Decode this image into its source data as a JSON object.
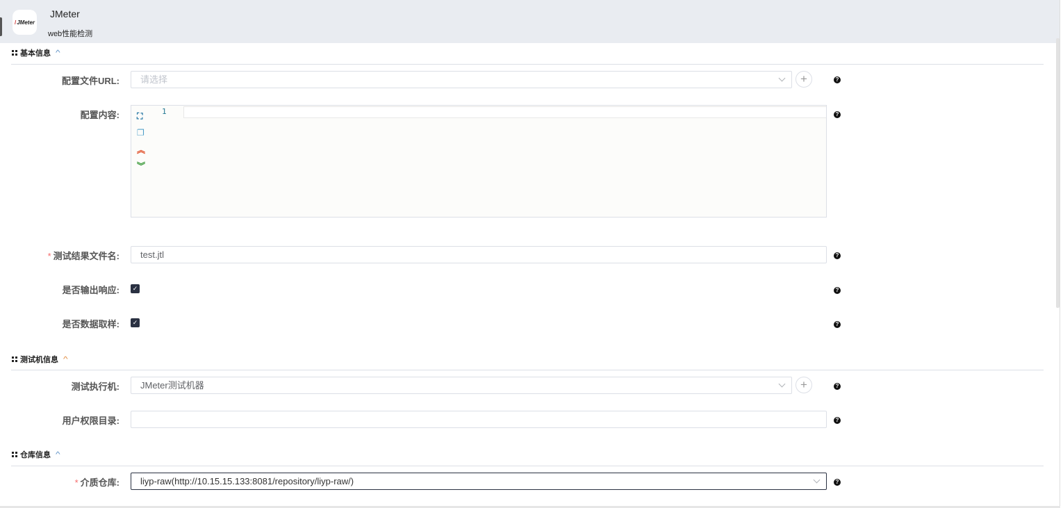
{
  "header": {
    "title": "JMeter",
    "subtitle": "web性能检测",
    "logo_text": "JMeter"
  },
  "sections": {
    "basic": {
      "title": "基本信息"
    },
    "machine": {
      "title": "测试机信息"
    },
    "repo": {
      "title": "仓库信息"
    }
  },
  "fields": {
    "config_url": {
      "label": "配置文件URL:",
      "placeholder": "请选择"
    },
    "config_content": {
      "label": "配置内容:",
      "line_number": "1"
    },
    "result_file": {
      "label": "测试结果文件名:",
      "value": "test.jtl",
      "required": "*"
    },
    "output_response": {
      "label": "是否输出响应:",
      "checked": true
    },
    "data_sampling": {
      "label": "是否数据取样:",
      "checked": true
    },
    "executor": {
      "label": "测试执行机:",
      "value": "JMeter测试机器"
    },
    "user_dir": {
      "label": "用户权限目录:",
      "value": ""
    },
    "repository": {
      "label": "介质仓库:",
      "value": "liyp-raw(http://10.15.15.133:8081/repository/liyp-raw/)",
      "required": "*"
    }
  },
  "icons": {
    "help": "?",
    "plus": "+",
    "check": "✓"
  }
}
